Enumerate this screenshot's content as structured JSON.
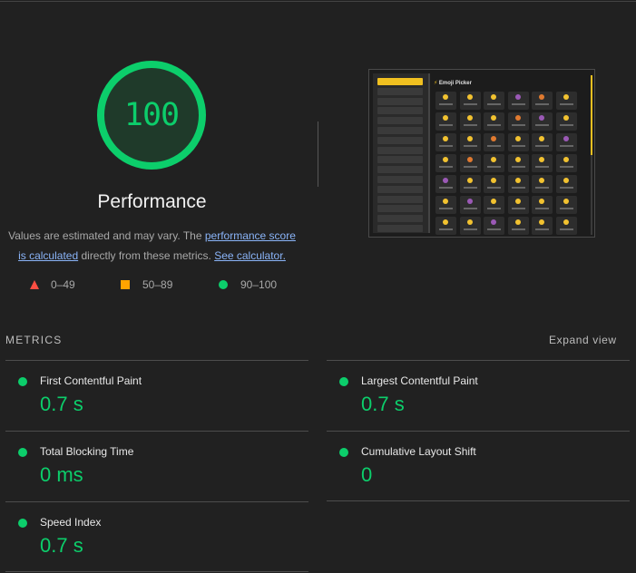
{
  "gauge": {
    "score": "100",
    "title": "Performance",
    "score_fraction": 1.0,
    "color": "#0cce6b"
  },
  "description": {
    "prefix": "Values are estimated and may vary. The ",
    "link1": "performance score is calculated",
    "middle": " directly from these metrics. ",
    "link2": "See calculator."
  },
  "legend": [
    {
      "range": "0–49",
      "color": "#ff4e42"
    },
    {
      "range": "50–89",
      "color": "#ffa400"
    },
    {
      "range": "90–100",
      "color": "#0cce6b"
    }
  ],
  "thumbnail": {
    "title": "Emoji Picker"
  },
  "metrics": {
    "header": "METRICS",
    "expand_label": "Expand view",
    "items": [
      {
        "label": "First Contentful Paint",
        "value": "0.7 s"
      },
      {
        "label": "Largest Contentful Paint",
        "value": "0.7 s"
      },
      {
        "label": "Total Blocking Time",
        "value": "0 ms"
      },
      {
        "label": "Cumulative Layout Shift",
        "value": "0"
      },
      {
        "label": "Speed Index",
        "value": "0.7 s"
      }
    ]
  }
}
